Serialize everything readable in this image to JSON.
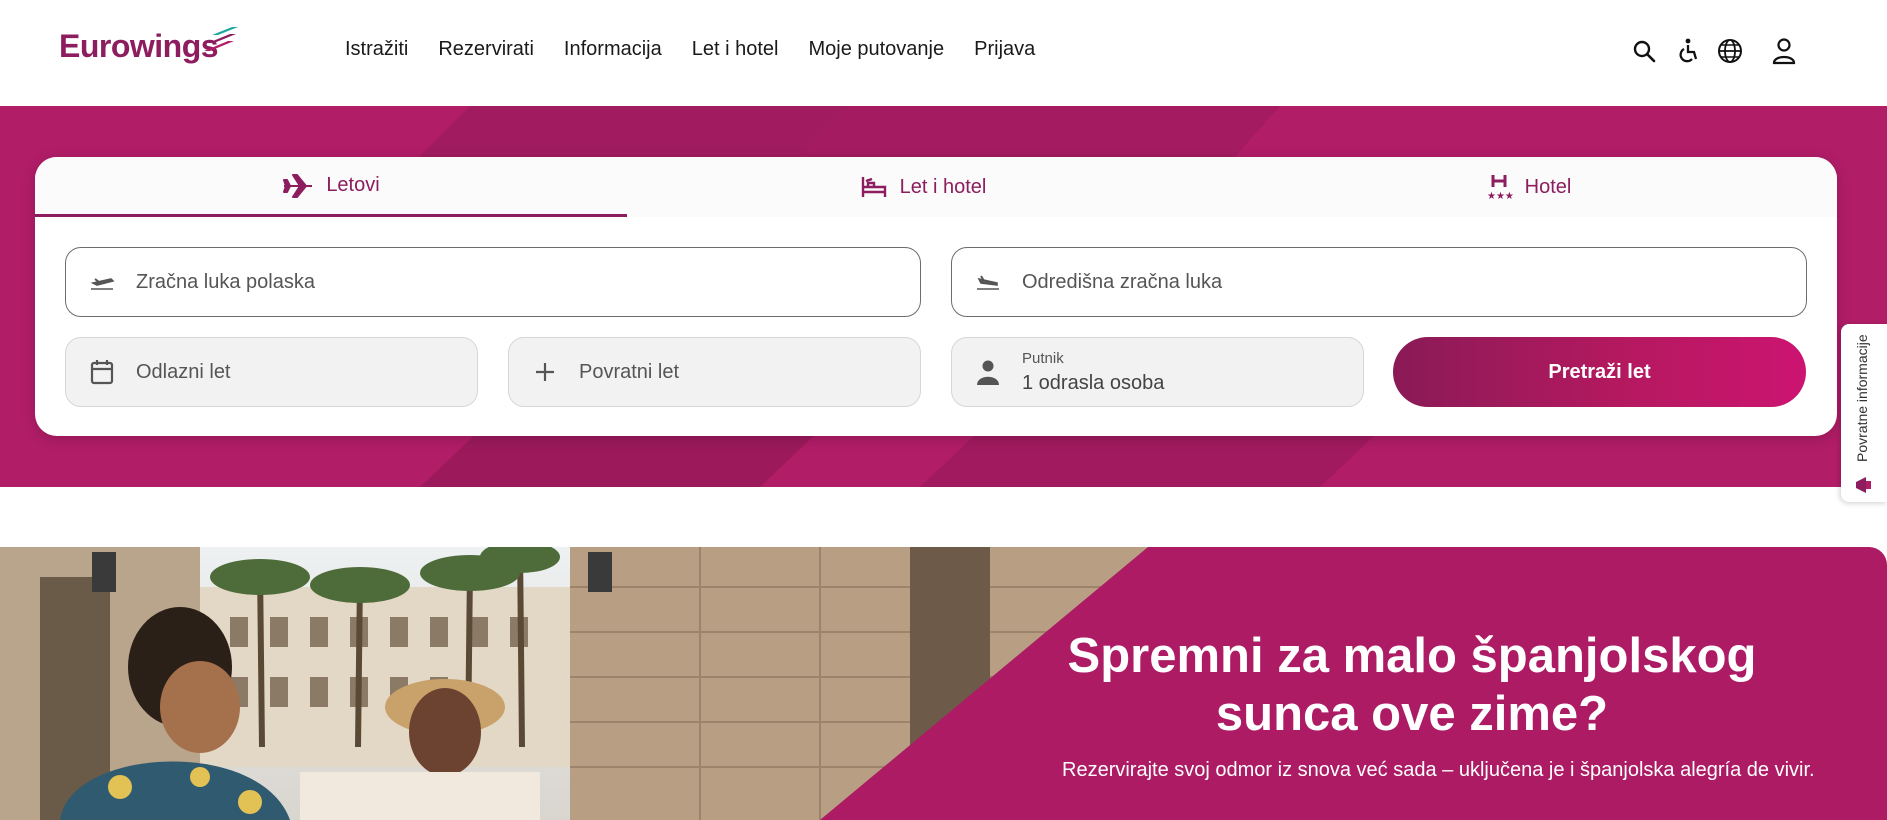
{
  "brand": {
    "name": "Eurowings",
    "color": "#8c1d5e",
    "accent": "#b21d68"
  },
  "nav": {
    "items": [
      {
        "label": "Istražiti"
      },
      {
        "label": "Rezervirati"
      },
      {
        "label": "Informacija"
      },
      {
        "label": "Let i hotel"
      },
      {
        "label": "Moje putovanje"
      },
      {
        "label": "Prijava"
      }
    ]
  },
  "header_icons": [
    "search-icon",
    "accessibility-icon",
    "globe-icon",
    "user-icon"
  ],
  "search": {
    "tabs": [
      {
        "label": "Letovi",
        "icon": "airplane-icon",
        "active": true
      },
      {
        "label": "Let i hotel",
        "icon": "bed-icon",
        "active": false
      },
      {
        "label": "Hotel",
        "icon": "hotel-stars-icon",
        "active": false
      }
    ],
    "origin_placeholder": "Zračna luka polaska",
    "destination_placeholder": "Odredišna zračna luka",
    "departure_placeholder": "Odlazni let",
    "return_placeholder": "Povratni let",
    "passenger_label": "Putnik",
    "passenger_value": "1 odrasla osoba",
    "search_button": "Pretraži let"
  },
  "feedback": {
    "label": "Povratne informacije"
  },
  "promo": {
    "title": "Spremni za malo španjolskog sunca ove zime?",
    "subtitle": "Rezervirajte svoj odmor iz snova već sada – uključena je i španjolska alegría de vivir."
  }
}
